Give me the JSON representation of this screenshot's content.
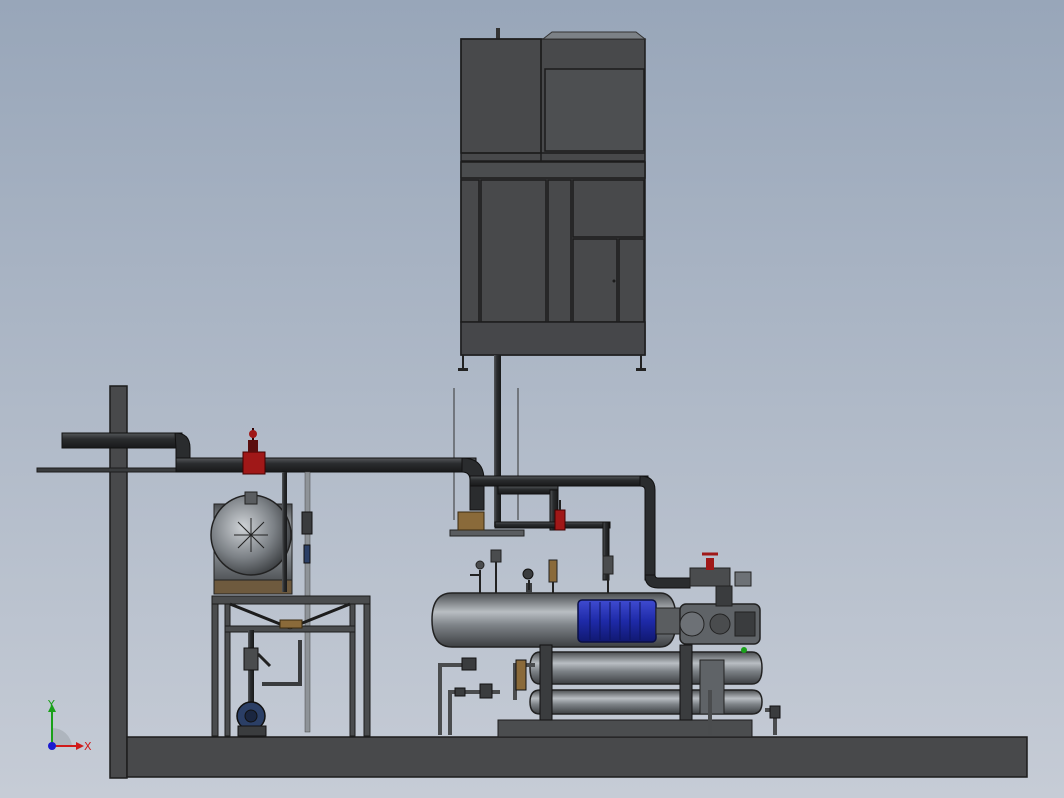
{
  "viewport": {
    "background_top": "#98a6b9",
    "background_bottom": "#c6ccd6"
  },
  "colors": {
    "steel_dark": "#3a3c3e",
    "steel_mid": "#5a5d60",
    "steel_light": "#9ea3a8",
    "pipe": "#2c2e30",
    "motor_blue": "#1e2aa8",
    "pump_blue": "#2b3f66",
    "valve_red": "#a01818",
    "bronze": "#8a6a3a"
  },
  "coordinate_triad": {
    "x_label": "X",
    "y_label": "Y",
    "x_color": "#d01a1a",
    "y_color": "#1aa01a",
    "z_color": "#1a1ad0"
  },
  "components": [
    {
      "name": "cooling-tower",
      "icon": "cooling-tower-icon"
    },
    {
      "name": "receiver-tank",
      "icon": "pressure-vessel-icon"
    },
    {
      "name": "oil-separator-tank",
      "icon": "horizontal-vessel-icon"
    },
    {
      "name": "compressor-motor",
      "icon": "motor-icon"
    },
    {
      "name": "screw-compressor",
      "icon": "compressor-icon"
    },
    {
      "name": "shell-tube-heat-exchanger",
      "icon": "heat-exchanger-icon"
    },
    {
      "name": "water-pump",
      "icon": "pump-icon"
    },
    {
      "name": "support-frame",
      "icon": "frame-icon"
    },
    {
      "name": "base-skid",
      "icon": "skid-icon"
    }
  ]
}
